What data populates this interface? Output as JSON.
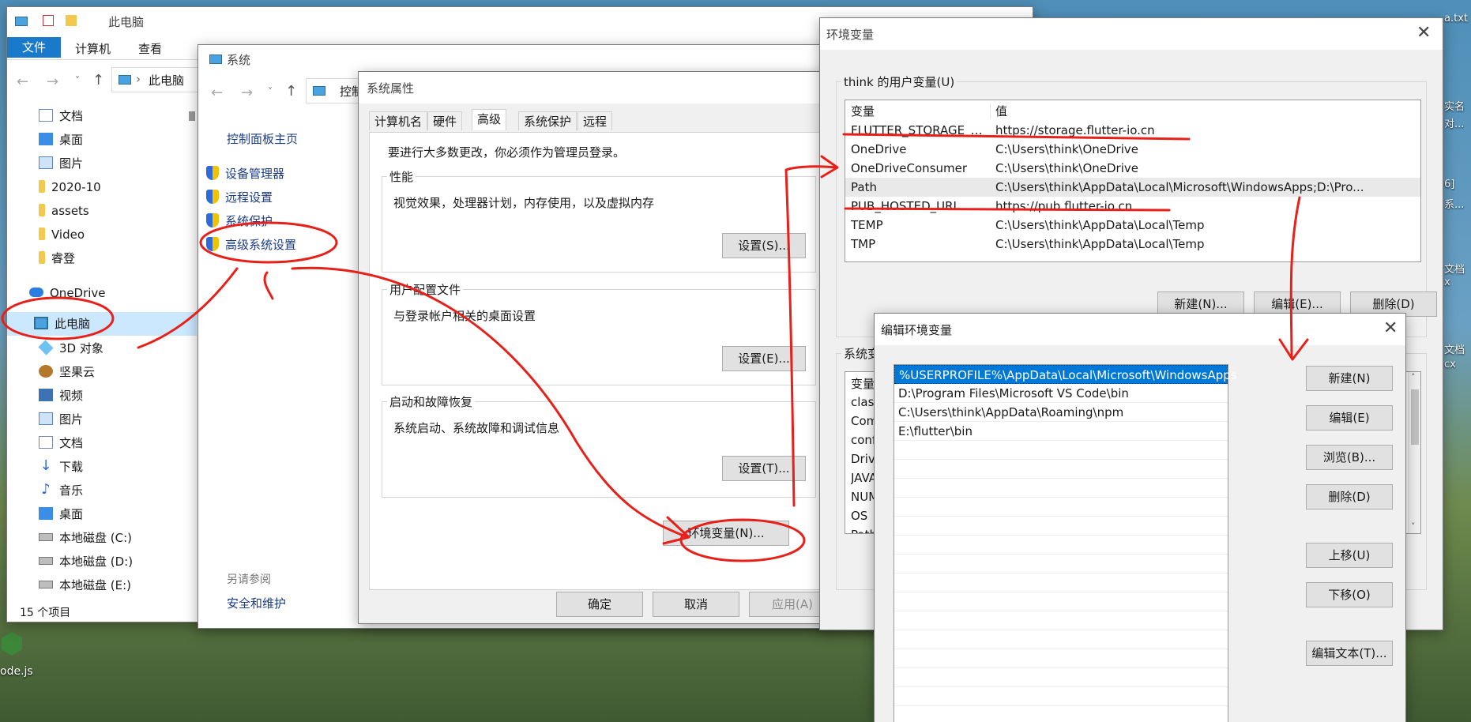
{
  "explorer": {
    "title": "此电脑",
    "ribbon_tabs": [
      "文件",
      "计算机",
      "查看"
    ],
    "address": "此电脑",
    "nav": [
      {
        "label": "文档",
        "icon": "document-icon"
      },
      {
        "label": "桌面",
        "icon": "desktop-icon"
      },
      {
        "label": "图片",
        "icon": "pictures-icon"
      },
      {
        "label": "2020-10",
        "icon": "folder-icon"
      },
      {
        "label": "assets",
        "icon": "folder-icon"
      },
      {
        "label": "Video",
        "icon": "folder-icon"
      },
      {
        "label": "睿登",
        "icon": "folder-icon"
      },
      {
        "label": "OneDrive",
        "icon": "onedrive-icon"
      },
      {
        "label": "此电脑",
        "icon": "this-pc-icon"
      },
      {
        "label": "3D 对象",
        "icon": "3d-objects-icon"
      },
      {
        "label": "坚果云",
        "icon": "nutstore-icon"
      },
      {
        "label": "视频",
        "icon": "videos-icon"
      },
      {
        "label": "图片",
        "icon": "pictures-icon"
      },
      {
        "label": "文档",
        "icon": "document-icon"
      },
      {
        "label": "下载",
        "icon": "download-icon"
      },
      {
        "label": "音乐",
        "icon": "music-icon"
      },
      {
        "label": "桌面",
        "icon": "desktop-icon"
      },
      {
        "label": "本地磁盘 (C:)",
        "icon": "drive-icon"
      },
      {
        "label": "本地磁盘 (D:)",
        "icon": "drive-icon"
      },
      {
        "label": "本地磁盘 (E:)",
        "icon": "drive-icon"
      }
    ],
    "status": "15 个项目"
  },
  "system": {
    "title": "系统",
    "address": "控制",
    "home_link": "控制面板主页",
    "links": [
      "设备管理器",
      "远程设置",
      "系统保护",
      "高级系统设置"
    ],
    "see_also": "另请参阅",
    "security_link": "安全和维护"
  },
  "sysprops": {
    "title": "系统属性",
    "tabs": [
      "计算机名",
      "硬件",
      "高级",
      "系统保护",
      "远程"
    ],
    "admin_note": "要进行大多数更改，你必须作为管理员登录。",
    "perf_title": "性能",
    "perf_desc": "视觉效果，处理器计划，内存使用，以及虚拟内存",
    "perf_btn": "设置(S)...",
    "profile_title": "用户配置文件",
    "profile_desc": "与登录帐户相关的桌面设置",
    "profile_btn": "设置(E)...",
    "startup_title": "启动和故障恢复",
    "startup_desc": "系统启动、系统故障和调试信息",
    "startup_btn": "设置(T)...",
    "env_btn": "环境变量(N)...",
    "ok": "确定",
    "cancel": "取消",
    "apply": "应用(A)"
  },
  "envvars": {
    "title": "环境变量",
    "user_group": "think 的用户变量(U)",
    "col_var": "变量",
    "col_val": "值",
    "user_vars": [
      {
        "name": "FLUTTER_STORAGE_BASE_...",
        "value": "https://storage.flutter-io.cn"
      },
      {
        "name": "OneDrive",
        "value": "C:\\Users\\think\\OneDrive"
      },
      {
        "name": "OneDriveConsumer",
        "value": "C:\\Users\\think\\OneDrive"
      },
      {
        "name": "Path",
        "value": "C:\\Users\\think\\AppData\\Local\\Microsoft\\WindowsApps;D:\\Pro..."
      },
      {
        "name": "PUB_HOSTED_URL",
        "value": "https://pub.flutter-io.cn"
      },
      {
        "name": "TEMP",
        "value": "C:\\Users\\think\\AppData\\Local\\Temp"
      },
      {
        "name": "TMP",
        "value": "C:\\Users\\think\\AppData\\Local\\Temp"
      }
    ],
    "new_btn": "新建(N)...",
    "edit_btn": "编辑(E)...",
    "delete_btn": "删除(D)",
    "sys_group": "系统变",
    "sys_col_var": "变量",
    "sys_vars": [
      "clas",
      "Com",
      "conf",
      "Driv",
      "JAVA",
      "NUM",
      "OS",
      "Path"
    ]
  },
  "editenv": {
    "title": "编辑环境变量",
    "entries": [
      "%USERPROFILE%\\AppData\\Local\\Microsoft\\WindowsApps",
      "D:\\Program Files\\Microsoft VS Code\\bin",
      "C:\\Users\\think\\AppData\\Roaming\\npm",
      "E:\\flutter\\bin"
    ],
    "buttons": [
      "新建(N)",
      "编辑(E)",
      "浏览(B)...",
      "删除(D)",
      "上移(U)",
      "下移(O)",
      "编辑文本(T)..."
    ]
  },
  "desktop": {
    "nodejs_label": "ode.js",
    "right_fragments": [
      "a.txt",
      "实名",
      "对...",
      "6]",
      "系...",
      "文档",
      "x",
      "文档",
      "cx"
    ]
  },
  "colors": {
    "accent": "#0078d7",
    "annotation": "#e8201a"
  }
}
